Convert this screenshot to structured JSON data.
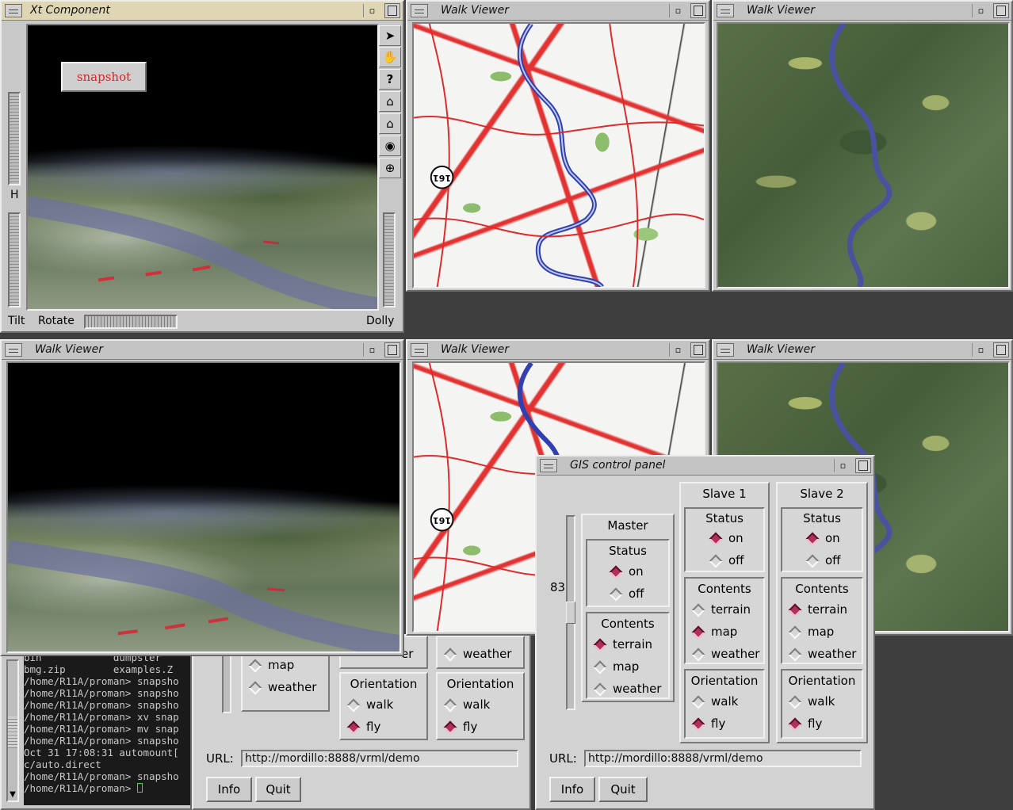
{
  "windows": {
    "xt": {
      "title": "Xt Component",
      "snapshot_label": "snapshot",
      "h_label": "H",
      "tilt_label": "Tilt",
      "rotate_label": "Rotate",
      "dolly_label": "Dolly",
      "tools": [
        "arrow-icon",
        "hand-icon",
        "question-icon",
        "home-icon",
        "set-home-icon",
        "view-all-icon",
        "seek-icon"
      ]
    },
    "walk_map_top": {
      "title": "Walk Viewer",
      "label_161": "161"
    },
    "walk_sat_top": {
      "title": "Walk Viewer"
    },
    "walk_terrain_bottom": {
      "title": "Walk Viewer"
    },
    "walk_map_bottom": {
      "title": "Walk Viewer",
      "label_161": "161"
    },
    "walk_sat_bottom": {
      "title": "Walk Viewer"
    }
  },
  "terminal": {
    "lines": [
      "bin            dumpster",
      "bmg.zip        examples.Z",
      "/home/R11A/proman> snapsho",
      "/home/R11A/proman> snapsho",
      "/home/R11A/proman> snapsho",
      "/home/R11A/proman> xv snap",
      "/home/R11A/proman> mv snap",
      "/home/R11A/proman> snapsho",
      "Oct 31 17:08:31 automount[",
      "c/auto.direct",
      "/home/R11A/proman> snapsho",
      "/home/R11A/proman> "
    ]
  },
  "back_panel": {
    "map": "map",
    "weather": "weather",
    "weather2": "weather",
    "orientation": "Orientation",
    "walk": "walk",
    "fly": "fly",
    "url_label": "URL:",
    "url_value": "http://mordillo:8888/vrml/demo",
    "info": "Info",
    "quit": "Quit"
  },
  "gis": {
    "title": "GIS control panel",
    "slider_value": "83",
    "slider_level": 0.5,
    "master": {
      "title": "Master",
      "status_title": "Status",
      "on": "on",
      "off": "off",
      "contents_title": "Contents",
      "terrain": "terrain",
      "map": "map",
      "weather": "weather"
    },
    "slave1": {
      "title": "Slave 1",
      "status_title": "Status",
      "on": "on",
      "off": "off",
      "contents_title": "Contents",
      "terrain": "terrain",
      "map": "map",
      "weather": "weather",
      "orientation_title": "Orientation",
      "walk": "walk",
      "fly": "fly"
    },
    "slave2": {
      "title": "Slave 2",
      "status_title": "Status",
      "on": "on",
      "off": "off",
      "contents_title": "Contents",
      "terrain": "terrain",
      "map": "map",
      "weather": "weather",
      "orientation_title": "Orientation",
      "walk": "walk",
      "fly": "fly"
    },
    "url_label": "URL:",
    "url_value": "http://mordillo:8888/vrml/demo",
    "info": "Info",
    "quit": "Quit"
  },
  "colors": {
    "selected_radio": "#b0305a",
    "active_titlebar": "#dfd7b4",
    "snapshot_text": "#e02020"
  }
}
